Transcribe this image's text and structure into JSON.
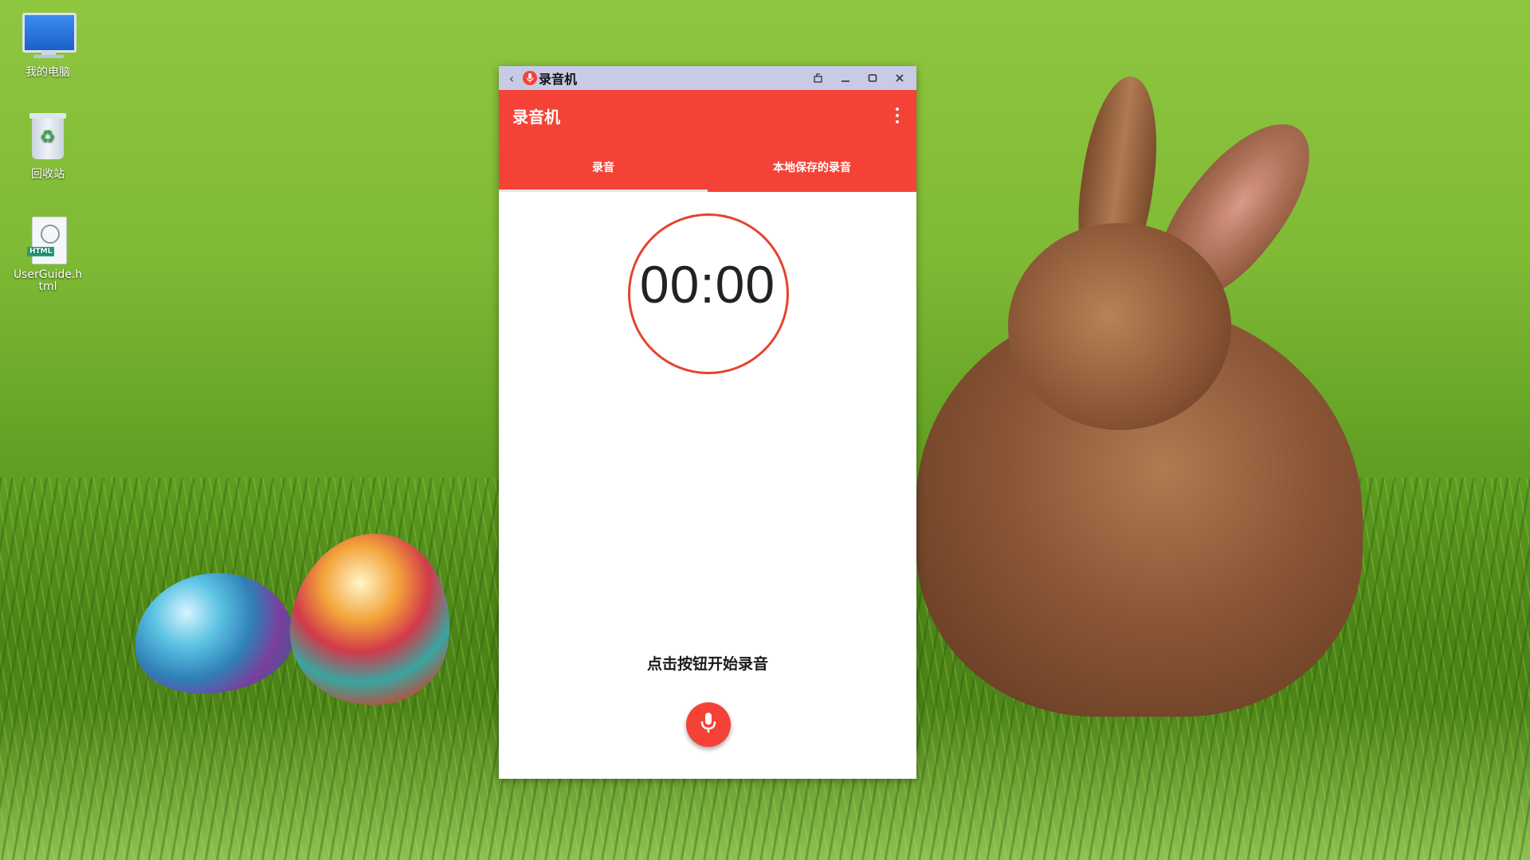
{
  "desktop": {
    "icons": [
      {
        "label": "我的电脑",
        "icon": "computer-icon"
      },
      {
        "label": "回收站",
        "icon": "recycle-bin-icon"
      },
      {
        "label": "UserGuide.html",
        "icon": "html-file-icon",
        "badge": "HTML"
      }
    ]
  },
  "window": {
    "title": "录音机",
    "controls": [
      "back-icon",
      "screen-rotate-icon",
      "minimize-icon",
      "maximize-icon",
      "close-icon"
    ]
  },
  "app": {
    "title": "录音机",
    "tabs": [
      {
        "label": "录音",
        "active": true
      },
      {
        "label": "本地保存的录音",
        "active": false
      }
    ],
    "timer": "00:00",
    "hint": "点击按钮开始录音",
    "mic_icon": "microphone-icon"
  },
  "colors": {
    "accent": "#f44336",
    "timer_ring": "#e5432f",
    "titlebar": "#c8cbe6"
  }
}
